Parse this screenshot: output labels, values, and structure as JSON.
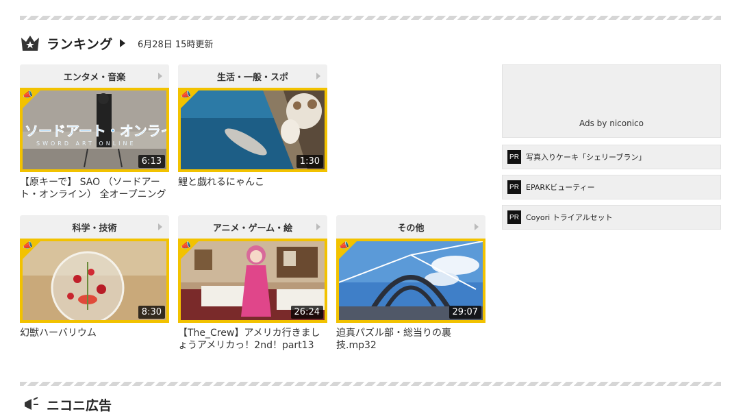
{
  "ranking": {
    "title": "ランキング",
    "updated": "6月28日 15時更新",
    "cards": [
      {
        "category": "エンタメ・音楽",
        "duration": "6:13",
        "title": "【原キーで】 SAO （ソードアート・オンライン） 全オープニング"
      },
      {
        "category": "生活・一般・スポ",
        "duration": "1:30",
        "title": "鯉と戯れるにゃんこ"
      },
      {
        "category": "科学・技術",
        "duration": "8:30",
        "title": "幻獣ハーバリウム"
      },
      {
        "category": "アニメ・ゲーム・絵",
        "duration": "26:24",
        "title": "【The_Crew】アメリカ行きましょうアメリカっ！2nd！part13"
      },
      {
        "category": "その他",
        "duration": "29:07",
        "title": "迫真パズル部・総当りの裏技.mp32"
      }
    ]
  },
  "ads": {
    "box_label": "Ads by niconico",
    "badge": "PR",
    "items": [
      "写真入りケーキ「シェリーブラン」",
      "EPARKビューティー",
      "Coyori トライアルセット"
    ]
  },
  "next_section": {
    "title": "ニコニ広告"
  },
  "colors": {
    "accent": "#f2c200",
    "header_bg": "#f0f0f0"
  }
}
